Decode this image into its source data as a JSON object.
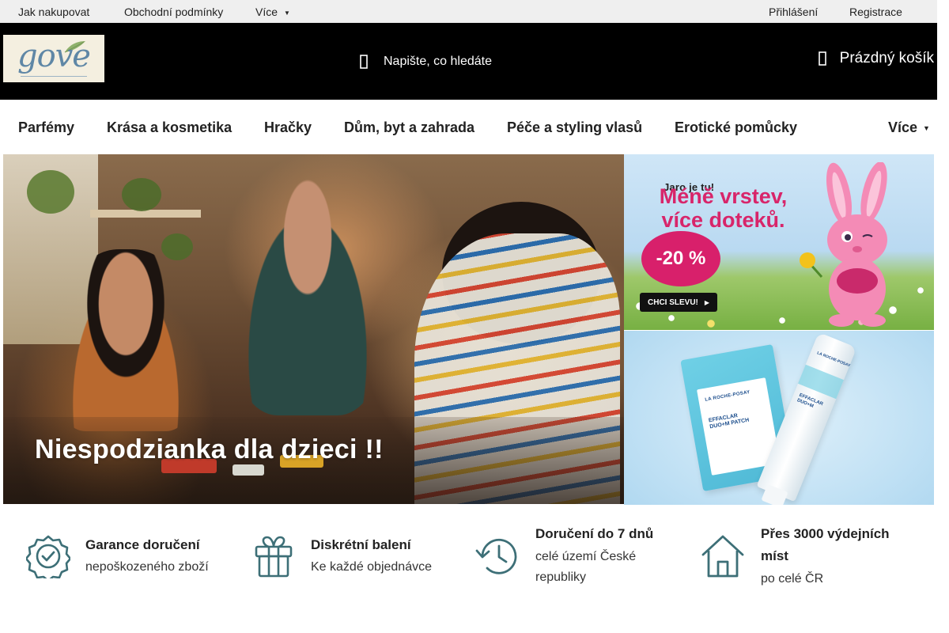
{
  "topbar": {
    "links": [
      "Jak nakupovat",
      "Obchodní podmínky",
      "Více"
    ],
    "more_caret": "▼",
    "auth": [
      "Přihlášení",
      "Registrace"
    ]
  },
  "header": {
    "logo_text": "gove",
    "search_placeholder": "Napište, co hledáte",
    "cart_label": "Prázdný košík"
  },
  "nav": {
    "items": [
      "Parfémy",
      "Krása a kosmetika",
      "Hračky",
      "Dům, byt a zahrada",
      "Péče a styling vlasů",
      "Erotické pomůcky",
      "Více"
    ],
    "more_chevron": "▼"
  },
  "hero": {
    "title": "Niespodzianka dla dzieci !!"
  },
  "banners": {
    "spring": {
      "kicker": "Jaro je tu!",
      "headline_line1": "Méně vrstev,",
      "headline_line2": "více doteků.",
      "badge": "-20 %",
      "cta": "CHCI SLEVU!",
      "cta_arrow": "▶"
    },
    "skincare": {
      "brand": "LA ROCHE-POSAY",
      "product_line1": "EFFACLAR",
      "product_line2": "DUO+M PATCH",
      "tube_line1": "EFFACLAR",
      "tube_line2": "DUO+M"
    }
  },
  "benefits": [
    {
      "title": "Garance doručení",
      "sub": [
        "nepoškozeného zboží"
      ],
      "icon": "badge-check-icon"
    },
    {
      "title": "Diskrétní balení",
      "sub": [
        "Ke každé objednávce"
      ],
      "icon": "gift-icon"
    },
    {
      "title": "Doručení do 7 dnů",
      "sub": [
        "celé území České",
        "republiky"
      ],
      "icon": "clock-history-icon"
    },
    {
      "title": "Přes 3000 výdejních",
      "title2": "míst",
      "sub": [
        "po celé ČR"
      ],
      "icon": "home-icon"
    }
  ],
  "colors": {
    "accent_teal": "#3d6f77",
    "header_bg": "#000000",
    "topbar_bg": "#efefef",
    "promo_pink": "#d8256a"
  }
}
